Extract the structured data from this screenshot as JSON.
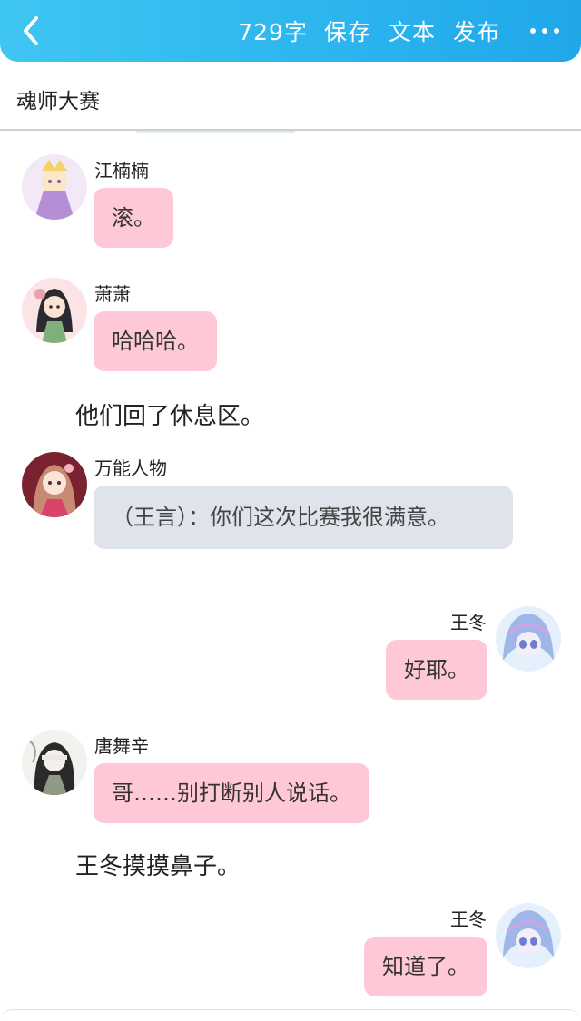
{
  "toolbar": {
    "word_count": "729字",
    "save_label": "保存",
    "text_label": "文本",
    "publish_label": "发布"
  },
  "story": {
    "title": "魂师大赛"
  },
  "chat": [
    {
      "type": "message",
      "side": "left",
      "name": "江楠楠",
      "text": "滚。",
      "bubble": "pink"
    },
    {
      "type": "message",
      "side": "left",
      "name": "萧萧",
      "text": "哈哈哈。",
      "bubble": "pink"
    },
    {
      "type": "narration",
      "text": "他们回了休息区。"
    },
    {
      "type": "message",
      "side": "left",
      "name": "万能人物",
      "text": "（王言）：你们这次比赛我很满意。",
      "bubble": "gray"
    },
    {
      "type": "message",
      "side": "right",
      "name": "王冬",
      "text": "好耶。",
      "bubble": "pink"
    },
    {
      "type": "message",
      "side": "left",
      "name": "唐舞辛",
      "text": "哥……别打断别人说话。",
      "bubble": "pink"
    },
    {
      "type": "narration",
      "text": "王冬摸摸鼻子。"
    },
    {
      "type": "message",
      "side": "right",
      "name": "王冬",
      "text": "知道了。",
      "bubble": "pink"
    }
  ],
  "colors": {
    "header_gradient_start": "#3fc6f2",
    "header_gradient_end": "#1fa7ea",
    "bubble_pink": "#ffc8d6",
    "bubble_gray": "#dfe3eb"
  },
  "icons": {
    "back": "chevron-left-icon",
    "more": "more-dots-icon"
  }
}
